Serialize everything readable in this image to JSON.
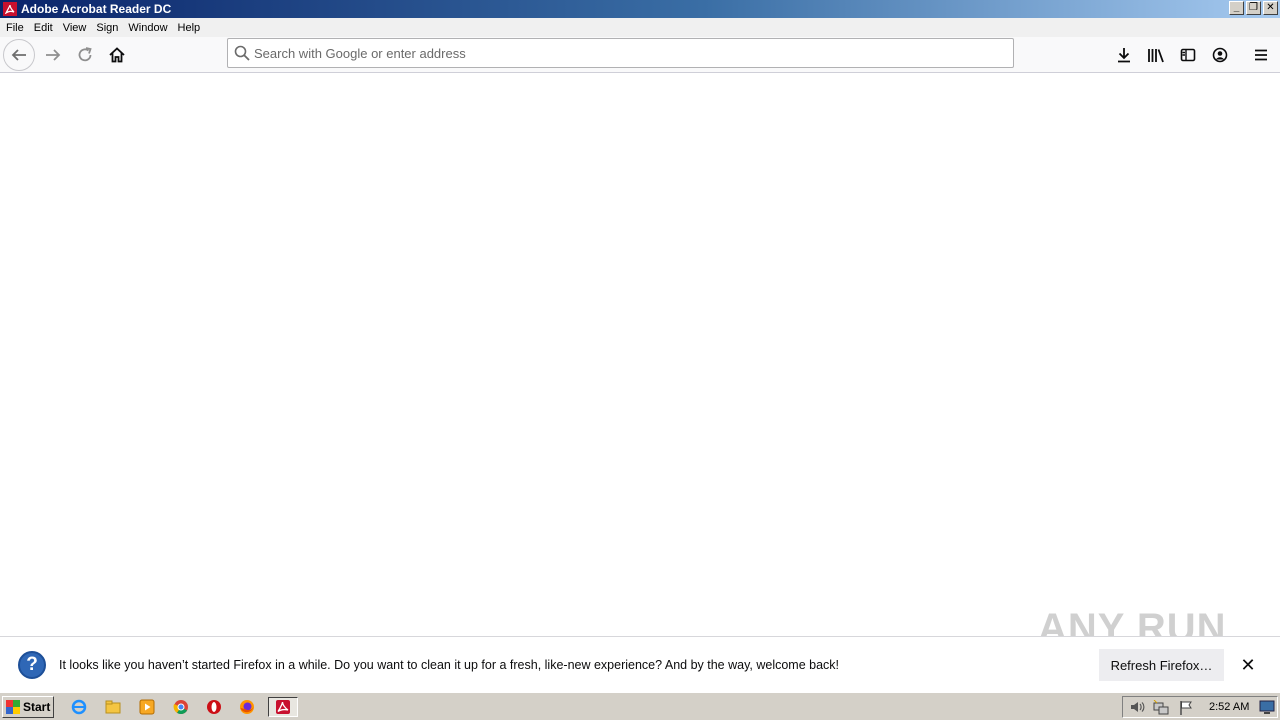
{
  "window": {
    "title": "Adobe Acrobat Reader DC"
  },
  "menu": [
    "File",
    "Edit",
    "View",
    "Sign",
    "Window",
    "Help"
  ],
  "urlbar": {
    "placeholder": "Search with Google or enter address",
    "value": ""
  },
  "notification": {
    "message": "It looks like you haven’t started Firefox in a while. Do you want to clean it up for a fresh, like-new experience? And by the way, welcome back!",
    "button_label": "Refresh Firefox…"
  },
  "watermark": "ANY RUN",
  "taskbar": {
    "start_label": "Start",
    "clock": "2:52 AM",
    "apps": [
      "internet-explorer-icon",
      "file-explorer-icon",
      "media-player-icon",
      "chrome-icon",
      "opera-icon",
      "firefox-icon",
      "acrobat-icon"
    ]
  },
  "colors": {
    "acrobat_red": "#c8102e",
    "titlebar_start": "#0a246a",
    "titlebar_end": "#a6caf0",
    "info_blue": "#2f67b6"
  }
}
